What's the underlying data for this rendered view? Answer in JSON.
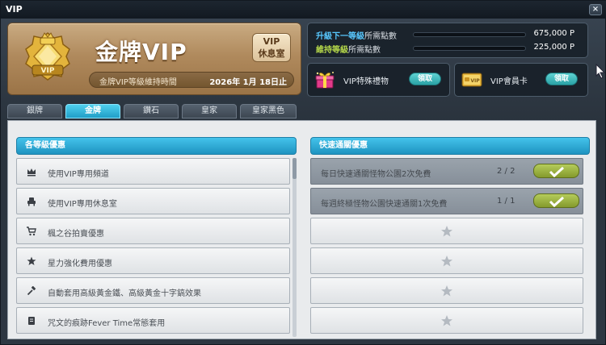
{
  "window": {
    "title": "VIP",
    "close_label": "×"
  },
  "card": {
    "title": "金牌VIP",
    "lounge_button_line1": "VIP",
    "lounge_button_line2": "休息室",
    "maintain_label": "金牌VIP等級維持時間",
    "maintain_date": "2026年 1月 18日止"
  },
  "points": {
    "next_level_highlight": "升級下一等級",
    "next_level_suffix": "所需點數",
    "next_level_value": "675,000 P",
    "maintain_highlight": "維持等級",
    "maintain_suffix": "所需點數",
    "maintain_value": "225,000 P"
  },
  "rewards": [
    {
      "label": "VIP特殊禮物",
      "button": "領取"
    },
    {
      "label": "VIP會員卡",
      "button": "領取"
    }
  ],
  "tabs": [
    {
      "label": "銀牌"
    },
    {
      "label": "金牌"
    },
    {
      "label": "鑽石"
    },
    {
      "label": "皇家"
    },
    {
      "label": "皇家黑色"
    }
  ],
  "active_tab": "金牌",
  "benefits_header": "各等級優惠",
  "benefits": [
    {
      "icon": "crown-icon",
      "label": "使用VIP專用頻道"
    },
    {
      "icon": "armchair-icon",
      "label": "使用VIP專用休息室"
    },
    {
      "icon": "cart-icon",
      "label": "楓之谷拍賣優惠"
    },
    {
      "icon": "star-icon",
      "label": "星力強化費用優惠"
    },
    {
      "icon": "hammer-icon",
      "label": "自動套用高級黃金鐵、高級黃金十字鎬效果"
    },
    {
      "icon": "scroll-icon",
      "label": "咒文的痕跡Fever Time常態套用"
    }
  ],
  "quick_header": "快速通關優惠",
  "quick": [
    {
      "label": "每日快速通關怪物公園2次免費",
      "count": "2 / 2"
    },
    {
      "label": "每週終極怪物公園快速通關1次免費",
      "count": "1 / 1"
    }
  ]
}
